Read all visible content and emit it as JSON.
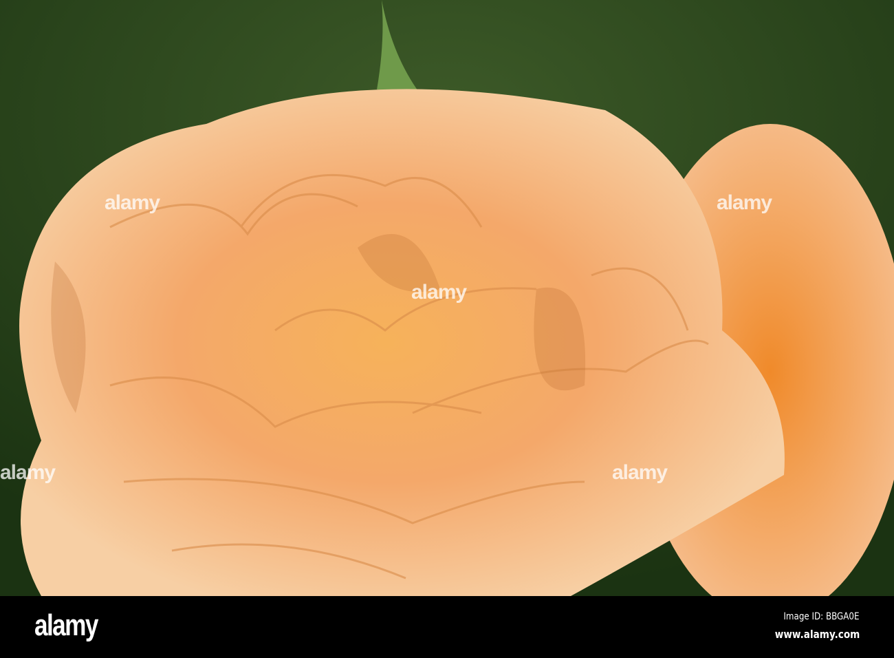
{
  "photo": {
    "subject": "orange rose",
    "colors": {
      "background": "#2c4a1e",
      "petal_light": "#f8d0a0",
      "petal_mid": "#f2a868",
      "petal_deep": "#e8781e"
    }
  },
  "watermark": {
    "text": "alamy"
  },
  "footer": {
    "logo": "alamy",
    "image_id": "Image ID: BBGA0E",
    "url": "www.alamy.com"
  }
}
